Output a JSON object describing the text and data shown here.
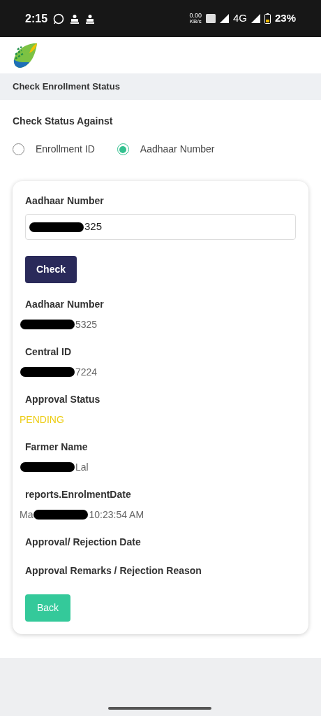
{
  "status_bar": {
    "time": "2:15",
    "speed": "0.00",
    "speed_unit": "KB/s",
    "network": "4G",
    "battery": "23%"
  },
  "header": {
    "title": "Check Enrollment Status"
  },
  "search_by": {
    "label": "Check Status Against",
    "options": [
      {
        "label": "Enrollment ID",
        "selected": false
      },
      {
        "label": "Aadhaar Number",
        "selected": true
      }
    ]
  },
  "form": {
    "field_label": "Aadhaar Number",
    "value": [
      {
        "kind": "redacted"
      },
      {
        "kind": "text",
        "text": "325"
      }
    ],
    "button": "Check"
  },
  "details": [
    {
      "label": "Aadhaar Number",
      "value": [
        {
          "kind": "redacted"
        },
        {
          "kind": "text",
          "text": "5325"
        }
      ]
    },
    {
      "label": "Central ID",
      "value": [
        {
          "kind": "redacted"
        },
        {
          "kind": "text",
          "text": "7224"
        }
      ]
    },
    {
      "label": "Approval Status",
      "color": "#eccc12",
      "value": [
        {
          "kind": "text",
          "text": "PENDING"
        }
      ]
    },
    {
      "label": "Farmer Name",
      "value": [
        {
          "kind": "redacted"
        },
        {
          "kind": "text",
          "text": "Lal"
        }
      ]
    },
    {
      "label": "reports.EnrolmentDate",
      "value": [
        {
          "kind": "text",
          "text": "Ma"
        },
        {
          "kind": "redacted"
        },
        {
          "kind": "text",
          "text": "10:23:54 AM"
        }
      ]
    },
    {
      "label": "Approval/ Rejection Date"
    },
    {
      "label": "Approval Remarks / Rejection Reason"
    }
  ],
  "back_button": "Back"
}
